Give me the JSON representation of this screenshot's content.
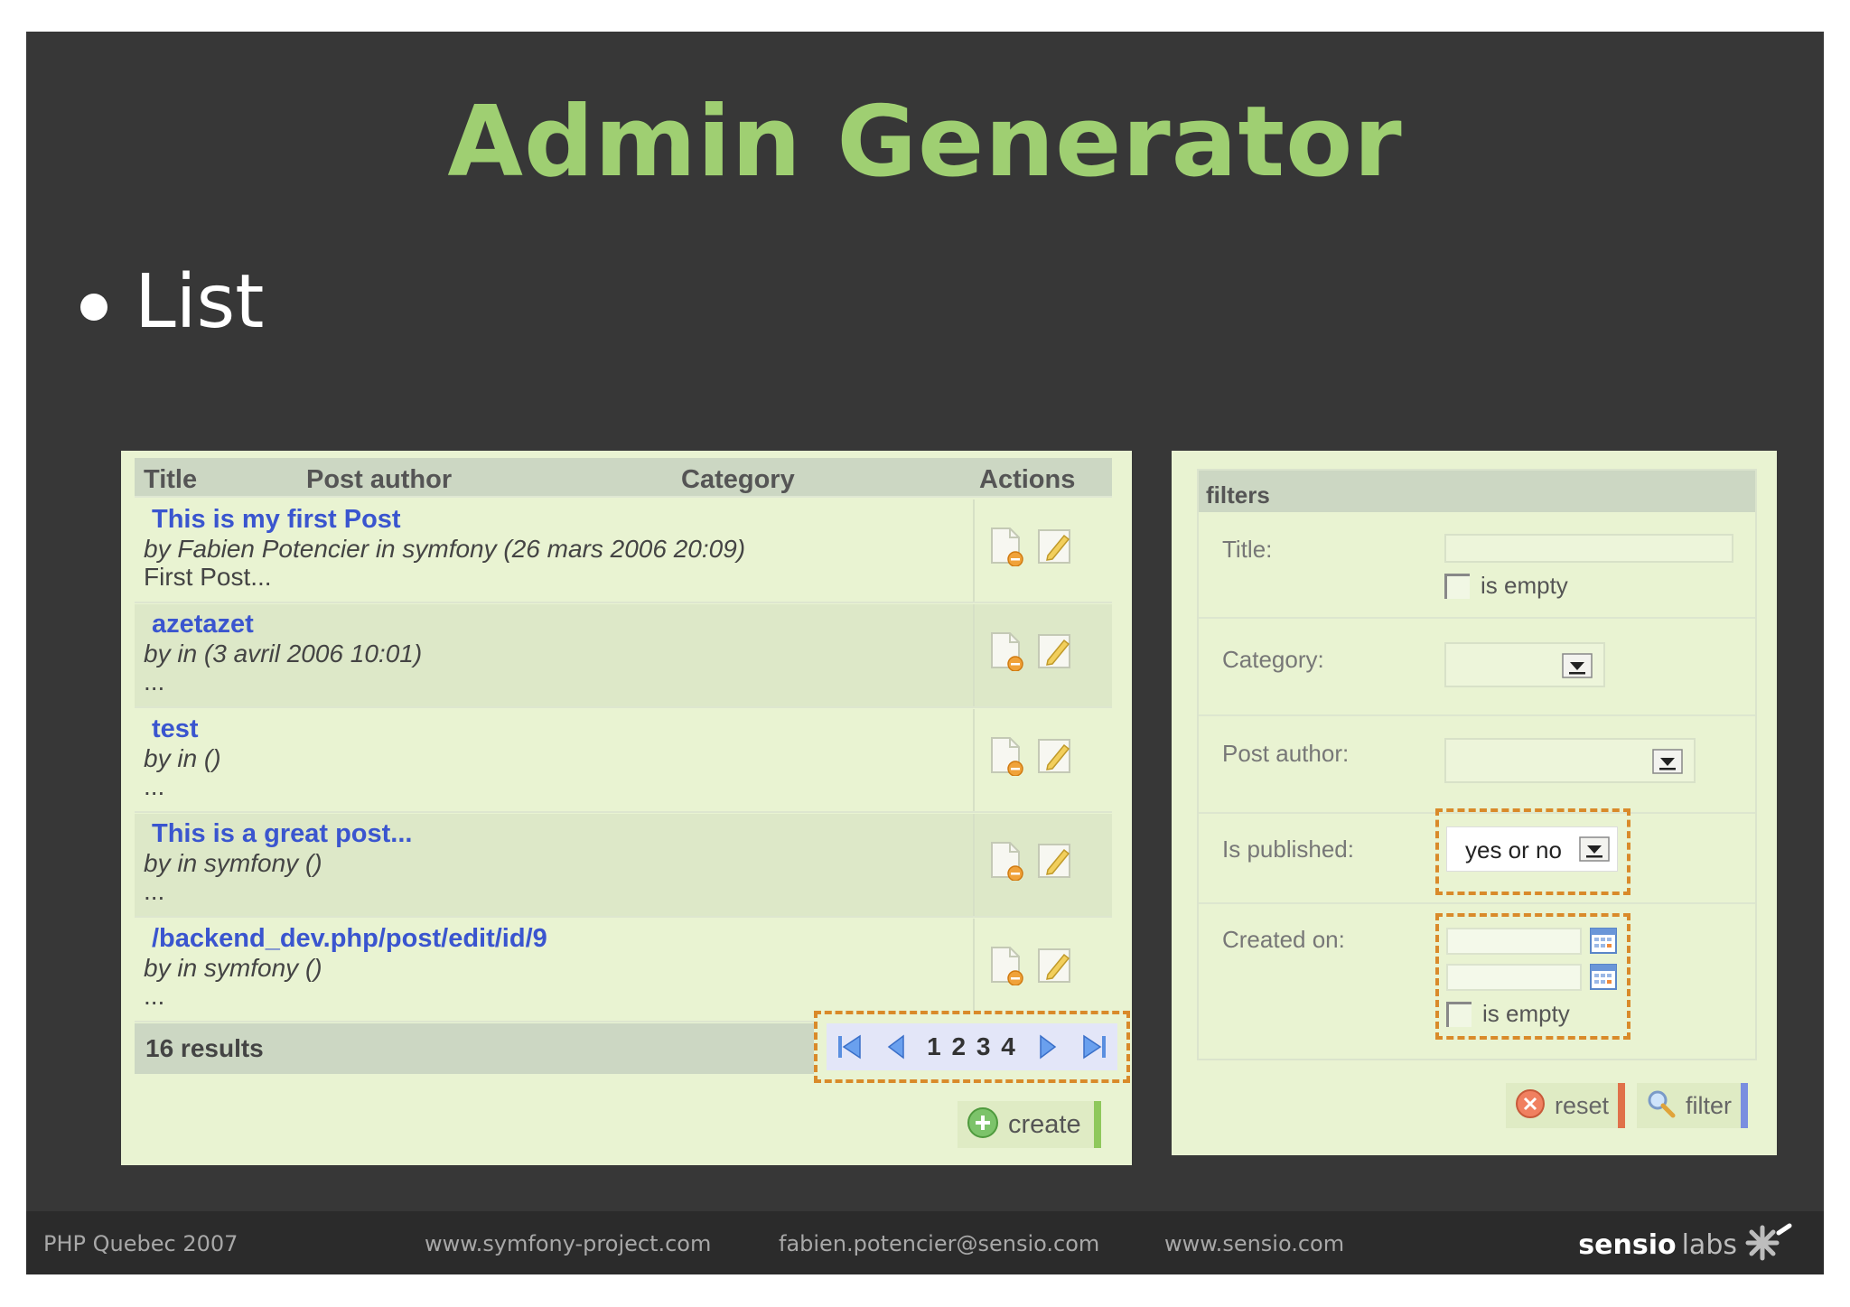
{
  "slide": {
    "title": "Admin Generator",
    "bullet": "List",
    "colors": {
      "background": "#373737",
      "title": "#9fcf72",
      "footer": "#2b2b2b",
      "accent_dash": "#d98a2a"
    }
  },
  "footer": {
    "event": "PHP Quebec 2007",
    "site": "www.symfony-project.com",
    "email": "fabien.potencier@sensio.com",
    "company_site": "www.sensio.com",
    "logo_bold": "sensio",
    "logo_light": "labs"
  },
  "list": {
    "columns": [
      "Title",
      "Post author",
      "Category",
      "Actions"
    ],
    "rows": [
      {
        "title": "This is my first Post",
        "byline": "by Fabien Potencier in symfony (26 mars 2006 20:09)",
        "excerpt": "First Post..."
      },
      {
        "title": "azetazet",
        "byline": "by in (3 avril 2006 10:01)",
        "excerpt": "..."
      },
      {
        "title": "test",
        "byline": "by in ()",
        "excerpt": "..."
      },
      {
        "title": "This is a great post...",
        "byline": "by in symfony ()",
        "excerpt": "..."
      },
      {
        "title": "/backend_dev.php/post/edit/id/9",
        "byline": "by in symfony ()",
        "excerpt": "..."
      }
    ],
    "results": "16 results",
    "pages": "1 2 3 4",
    "create_label": "create",
    "icons": {
      "delete": "document-delete-icon",
      "edit": "pencil-edit-icon",
      "first": "first-page-icon",
      "prev": "previous-page-icon",
      "next": "next-page-icon",
      "last": "last-page-icon",
      "create": "plus-circle-icon"
    }
  },
  "filters": {
    "legend": "filters",
    "title_label": "Title:",
    "title_value": "",
    "is_empty": "is empty",
    "category_label": "Category:",
    "category_value": "",
    "author_label": "Post author:",
    "author_value": "",
    "published_label": "Is published:",
    "published_value": "yes or no",
    "created_label": "Created on:",
    "reset_label": "reset",
    "filter_label": "filter",
    "icons": {
      "reset": "reset-circle-icon",
      "filter": "magnifier-icon",
      "calendar": "calendar-icon"
    }
  }
}
